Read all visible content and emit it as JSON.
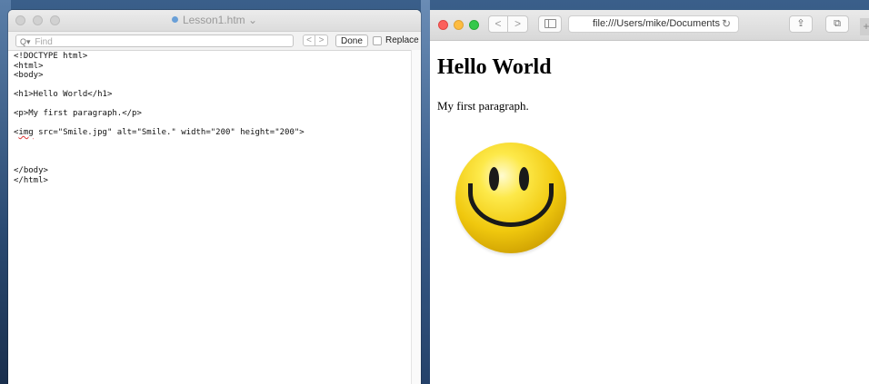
{
  "textedit": {
    "title": "Lesson1.htm",
    "title_chevron": "⌄",
    "find": {
      "placeholder": "Find",
      "prev_label": "<",
      "next_label": ">",
      "done_label": "Done",
      "replace_label": "Replace"
    },
    "lines": [
      "<!DOCTYPE html>",
      "<html>",
      "<body>",
      "",
      "<h1>Hello World</h1>",
      "",
      "<p>My first paragraph.</p>",
      "",
      "",
      "",
      "",
      "",
      "</body>",
      "</html>"
    ],
    "img_line": {
      "prefix": "<",
      "tag": "img",
      "rest": " src=\"Smile.jpg\" alt=\"Smile.\" width=\"200\" height=\"200\">"
    }
  },
  "safari": {
    "address": "file:///Users/mike/Documents",
    "reload_glyph": "↻",
    "back_glyph": "<",
    "forward_glyph": ">",
    "share_glyph": "⇪",
    "tabs_glyph": "⧉",
    "newtab_glyph": "+",
    "page": {
      "heading": "Hello World",
      "paragraph": "My first paragraph.",
      "image_alt": "Smile."
    }
  },
  "colors": {
    "desktop": "#2b4870",
    "close": "#fc605c",
    "minimize": "#fdbc40",
    "zoom": "#34c84a",
    "smiley_yellow": "#fde94a"
  }
}
